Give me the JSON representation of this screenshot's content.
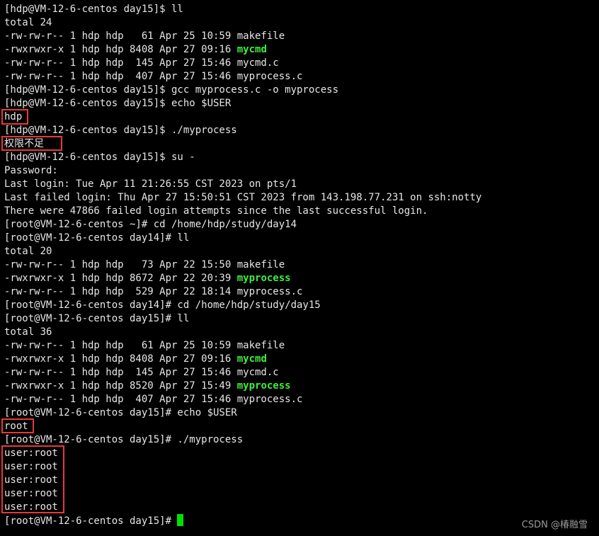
{
  "terminal": {
    "lines": [
      {
        "text": "[hdp@VM-12-6-centos day15]$ ll"
      },
      {
        "text": "total 24"
      },
      {
        "text": "-rw-rw-r-- 1 hdp hdp   61 Apr 25 10:59 makefile"
      },
      {
        "text": "-rwxrwxr-x 1 hdp hdp 8408 Apr 27 09:16 ",
        "highlight": "mycmd"
      },
      {
        "text": "-rw-rw-r-- 1 hdp hdp  145 Apr 27 15:46 mycmd.c"
      },
      {
        "text": "-rw-rw-r-- 1 hdp hdp  407 Apr 27 15:46 myprocess.c"
      },
      {
        "text": "[hdp@VM-12-6-centos day15]$ gcc myprocess.c -o myprocess"
      },
      {
        "text": "[hdp@VM-12-6-centos day15]$ echo $USER"
      },
      {
        "text": "hdp"
      },
      {
        "text": "[hdp@VM-12-6-centos day15]$ ./myprocess"
      },
      {
        "text": "权限不足"
      },
      {
        "text": "[hdp@VM-12-6-centos day15]$ su -"
      },
      {
        "text": "Password:"
      },
      {
        "text": "Last login: Tue Apr 11 21:26:55 CST 2023 on pts/1"
      },
      {
        "text": "Last failed login: Thu Apr 27 15:50:51 CST 2023 from 143.198.77.231 on ssh:notty"
      },
      {
        "text": "There were 47866 failed login attempts since the last successful login."
      },
      {
        "text": "[root@VM-12-6-centos ~]# cd /home/hdp/study/day14"
      },
      {
        "text": "[root@VM-12-6-centos day14]# ll"
      },
      {
        "text": "total 20"
      },
      {
        "text": "-rw-rw-r-- 1 hdp hdp   73 Apr 22 15:50 makefile"
      },
      {
        "text": "-rwxrwxr-x 1 hdp hdp 8672 Apr 22 20:39 ",
        "highlight": "myprocess"
      },
      {
        "text": "-rw-rw-r-- 1 hdp hdp  529 Apr 22 18:14 myprocess.c"
      },
      {
        "text": "[root@VM-12-6-centos day14]# cd /home/hdp/study/day15"
      },
      {
        "text": "[root@VM-12-6-centos day15]# ll"
      },
      {
        "text": "total 36"
      },
      {
        "text": "-rw-rw-r-- 1 hdp hdp   61 Apr 25 10:59 makefile"
      },
      {
        "text": "-rwxrwxr-x 1 hdp hdp 8408 Apr 27 09:16 ",
        "highlight": "mycmd"
      },
      {
        "text": "-rw-rw-r-- 1 hdp hdp  145 Apr 27 15:46 mycmd.c"
      },
      {
        "text": "-rwxrwxr-x 1 hdp hdp 8520 Apr 27 15:49 ",
        "highlight": "myprocess"
      },
      {
        "text": "-rw-rw-r-- 1 hdp hdp  407 Apr 27 15:46 myprocess.c"
      },
      {
        "text": "[root@VM-12-6-centos day15]# echo $USER"
      },
      {
        "text": "root"
      },
      {
        "text": "[root@VM-12-6-centos day15]# ./myprocess"
      },
      {
        "text": "user:root"
      },
      {
        "text": "user:root"
      },
      {
        "text": "user:root"
      },
      {
        "text": "user:root"
      },
      {
        "text": "user:root"
      },
      {
        "text": "[root@VM-12-6-centos day15]# ",
        "cursor": true
      }
    ]
  },
  "watermark": "CSDN @椿融雪",
  "colors": {
    "background": "#000000",
    "text": "#e6e6e6",
    "executable": "#3cf03c",
    "annotation_box": "#e8383c",
    "cursor": "#00e000"
  }
}
